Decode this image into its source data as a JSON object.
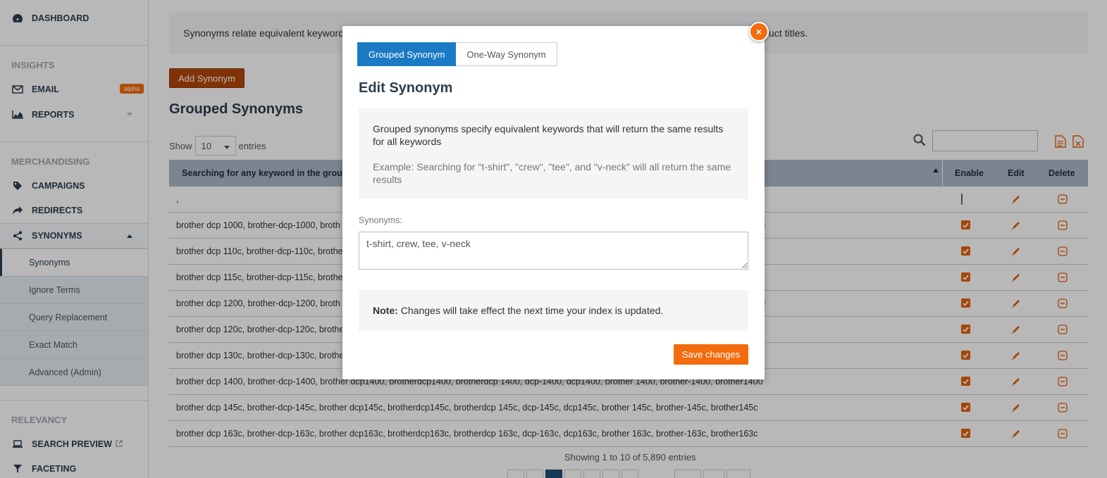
{
  "sidebar": {
    "dashboard": "DASHBOARD",
    "insights_header": "INSIGHTS",
    "email": "EMAIL",
    "email_badge": "alpha",
    "reports": "REPORTS",
    "merch_header": "MERCHANDISING",
    "campaigns": "CAMPAIGNS",
    "redirects": "REDIRECTS",
    "synonyms": "SYNONYMS",
    "sub_items": [
      "Synonyms",
      "Ignore Terms",
      "Query Replacement",
      "Exact Match",
      "Advanced (Admin)"
    ],
    "relevancy_header": "RELEVANCY",
    "search_preview": "SEARCH PREVIEW",
    "faceting": "FACETING"
  },
  "main": {
    "info_text": "Synonyms relate equivalent keyword",
    "info_tail": "uct titles.",
    "add_button": "Add Synonym",
    "title": "Grouped Synonyms",
    "show_label": "Show",
    "entries_value": "10",
    "entries_label": "entries",
    "table": {
      "col0": "Searching for any keyword in the group r",
      "col_enable": "Enable",
      "col_edit": "Edit",
      "col_delete": "Delete",
      "rows": [
        {
          "text": ",",
          "enabled": false
        },
        {
          "text": "brother dcp 1000, brother-dcp-1000, broth",
          "tail": "0",
          "enabled": true
        },
        {
          "text": "brother dcp 110c, brother-dcp-110c, brothe",
          "enabled": true
        },
        {
          "text": "brother dcp 115c, brother-dcp-115c, brothe",
          "enabled": true
        },
        {
          "text": "brother dcp 1200, brother-dcp-1200, broth",
          "tail": "0",
          "enabled": true
        },
        {
          "text": "brother dcp 120c, brother-dcp-120c, brothe",
          "enabled": true
        },
        {
          "text": "brother dcp 130c, brother-dcp-130c, brothe",
          "enabled": true
        },
        {
          "text": "brother dcp 1400, brother-dcp-1400, brother dcp1400, brotherdcp1400, brotherdcp 1400, dcp-1400, dcp1400, brother 1400, brother-1400, brother1400",
          "enabled": true
        },
        {
          "text": "brother dcp 145c, brother-dcp-145c, brother dcp145c, brotherdcp145c, brotherdcp 145c, dcp-145c, dcp145c, brother 145c, brother-145c, brother145c",
          "enabled": true
        },
        {
          "text": "brother dcp 163c, brother-dcp-163c, brother dcp163c, brotherdcp163c, brotherdcp 163c, dcp-163c, dcp163c, brother 163c, brother-163c, brother163c",
          "enabled": true
        }
      ]
    },
    "showing_text": "Showing 1 to 10 of 5,890 entries"
  },
  "modal": {
    "close_label": "×",
    "tab_grouped": "Grouped Synonym",
    "tab_oneway": "One-Way Synonym",
    "title": "Edit Synonym",
    "desc_p1": "Grouped synonyms specify equivalent keywords that will return the same results for all keywords",
    "desc_p2": "Example: Searching for \"t-shirt\", \"crew\", \"tee\", and \"v-neck\" will all return the same results",
    "synonyms_label": "Synonyms:",
    "synonyms_value": "t-shirt, crew, tee, v-neck",
    "note_label": "Note:",
    "note_text": "Changes will take effect the next time your index is updated.",
    "save_button": "Save changes"
  },
  "colors": {
    "accent": "#f26c0d",
    "primary_tab": "#1a7bc4",
    "header_bg": "#a9b9c8",
    "brand_dark": "#2c3e50"
  }
}
